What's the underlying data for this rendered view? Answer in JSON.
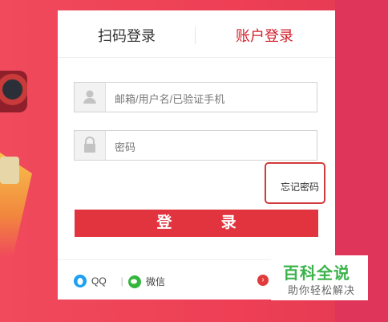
{
  "tabs": {
    "qr_login": "扫码登录",
    "account_login": "账户登录"
  },
  "form": {
    "username_placeholder": "邮箱/用户名/已验证手机",
    "password_placeholder": "密码",
    "forgot_password": "忘记密码",
    "login_button": "登 录"
  },
  "social": {
    "qq": "QQ",
    "wechat": "微信",
    "separator": "|"
  },
  "watermark": {
    "title": "百科全说",
    "subtitle": "助你轻松解决"
  },
  "colors": {
    "accent": "#e2343f",
    "brand_green": "#3bb34a",
    "background": "#ee3f55"
  },
  "icons": {
    "user": "user-icon",
    "lock": "lock-icon",
    "qq": "qq-icon",
    "wechat": "wechat-icon",
    "arrow": "arrow-right-icon"
  }
}
